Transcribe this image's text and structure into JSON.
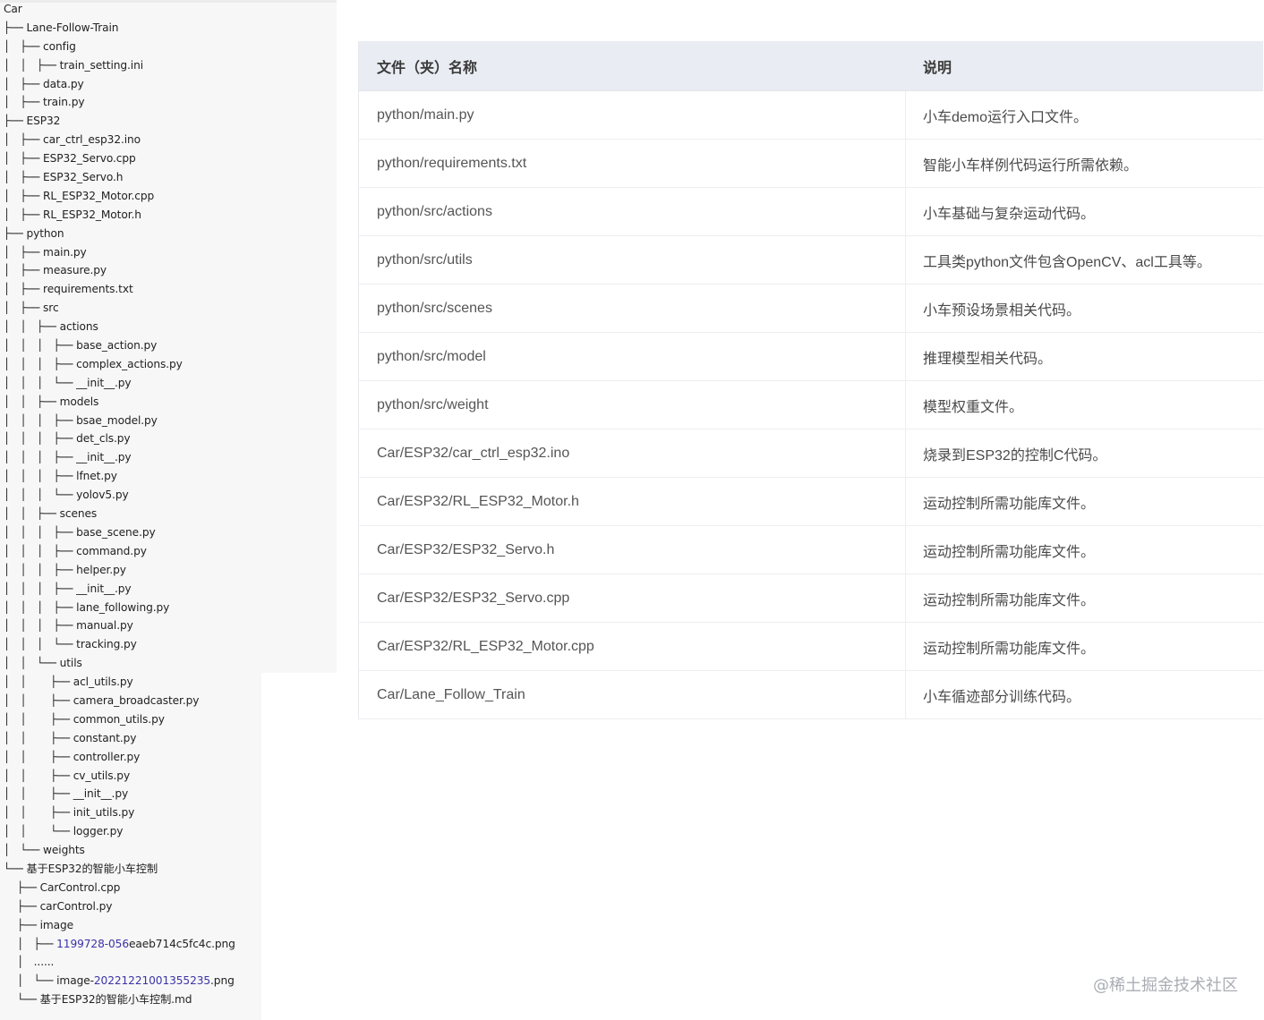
{
  "tree": [
    {
      "t": "Car"
    },
    {
      "t": "├── Lane-Follow-Train"
    },
    {
      "t": "│   ├── config"
    },
    {
      "t": "│   │   ├── train_setting.ini"
    },
    {
      "t": "│   ├── data.py"
    },
    {
      "t": "│   ├── train.py"
    },
    {
      "t": "├── ESP32"
    },
    {
      "t": "│   ├── car_ctrl_esp32.ino"
    },
    {
      "t": "│   ├── ESP32_Servo.cpp"
    },
    {
      "t": "│   ├── ESP32_Servo.h"
    },
    {
      "t": "│   ├── RL_ESP32_Motor.cpp"
    },
    {
      "t": "│   ├── RL_ESP32_Motor.h"
    },
    {
      "t": "├── python"
    },
    {
      "t": "│   ├── main.py"
    },
    {
      "t": "│   ├── measure.py"
    },
    {
      "t": "│   ├── requirements.txt"
    },
    {
      "t": "│   ├── src"
    },
    {
      "t": "│   │   ├── actions"
    },
    {
      "t": "│   │   │   ├── base_action.py"
    },
    {
      "t": "│   │   │   ├── complex_actions.py"
    },
    {
      "t": "│   │   │   └── __init__.py"
    },
    {
      "t": "│   │   ├── models"
    },
    {
      "t": "│   │   │   ├── bsae_model.py"
    },
    {
      "t": "│   │   │   ├── det_cls.py"
    },
    {
      "t": "│   │   │   ├── __init__.py"
    },
    {
      "t": "│   │   │   ├── lfnet.py"
    },
    {
      "t": "│   │   │   └── yolov5.py"
    },
    {
      "t": "│   │   ├── scenes"
    },
    {
      "t": "│   │   │   ├── base_scene.py"
    },
    {
      "t": "│   │   │   ├── command.py"
    },
    {
      "t": "│   │   │   ├── helper.py"
    },
    {
      "t": "│   │   │   ├── __init__.py"
    },
    {
      "t": "│   │   │   ├── lane_following.py"
    },
    {
      "t": "│   │   │   ├── manual.py"
    },
    {
      "t": "│   │   │   └── tracking.py"
    },
    {
      "t": "│   │   └── utils"
    },
    {
      "t": "│   │       ├── acl_utils.py"
    },
    {
      "t": "│   │       ├── camera_broadcaster.py"
    },
    {
      "t": "│   │       ├── common_utils.py"
    },
    {
      "t": "│   │       ├── constant.py"
    },
    {
      "t": "│   │       ├── controller.py"
    },
    {
      "t": "│   │       ├── cv_utils.py"
    },
    {
      "t": "│   │       ├── __init__.py"
    },
    {
      "t": "│   │       ├── init_utils.py"
    },
    {
      "t": "│   │       └── logger.py"
    },
    {
      "t": "│   └── weights"
    },
    {
      "t": "└── 基于ESP32的智能小车控制"
    },
    {
      "t": "    ├── CarControl.cpp"
    },
    {
      "t": "    ├── carControl.py"
    },
    {
      "t": "    ├── image"
    },
    {
      "t": "    │   ├── ",
      "h": "1199728-056",
      "r": "eaeb714c5fc4c.png"
    },
    {
      "t": "    │   ......"
    },
    {
      "t": "    │   └── image-",
      "h": "20221221001355235",
      "r": ".png"
    },
    {
      "t": "    └── 基于ESP32的智能小车控制.md"
    }
  ],
  "table": {
    "headers": [
      "文件（夹）名称",
      "说明"
    ],
    "rows": [
      [
        "python/main.py",
        "小车demo运行入口文件。"
      ],
      [
        "python/requirements.txt",
        "智能小车样例代码运行所需依赖。"
      ],
      [
        "python/src/actions",
        "小车基础与复杂运动代码。"
      ],
      [
        "python/src/utils",
        "工具类python文件包含OpenCV、acl工具等。"
      ],
      [
        "python/src/scenes",
        "小车预设场景相关代码。"
      ],
      [
        "python/src/model",
        "推理模型相关代码。"
      ],
      [
        "python/src/weight",
        "模型权重文件。"
      ],
      [
        "Car/ESP32/car_ctrl_esp32.ino",
        "烧录到ESP32的控制C代码。"
      ],
      [
        "Car/ESP32/RL_ESP32_Motor.h",
        "运动控制所需功能库文件。"
      ],
      [
        "Car/ESP32/ESP32_Servo.h",
        "运动控制所需功能库文件。"
      ],
      [
        "Car/ESP32/ESP32_Servo.cpp",
        "运动控制所需功能库文件。"
      ],
      [
        "Car/ESP32/RL_ESP32_Motor.cpp",
        "运动控制所需功能库文件。"
      ],
      [
        "Car/Lane_Follow_Train",
        "小车循迹部分训练代码。"
      ]
    ]
  },
  "watermark": "@稀土掘金技术社区"
}
